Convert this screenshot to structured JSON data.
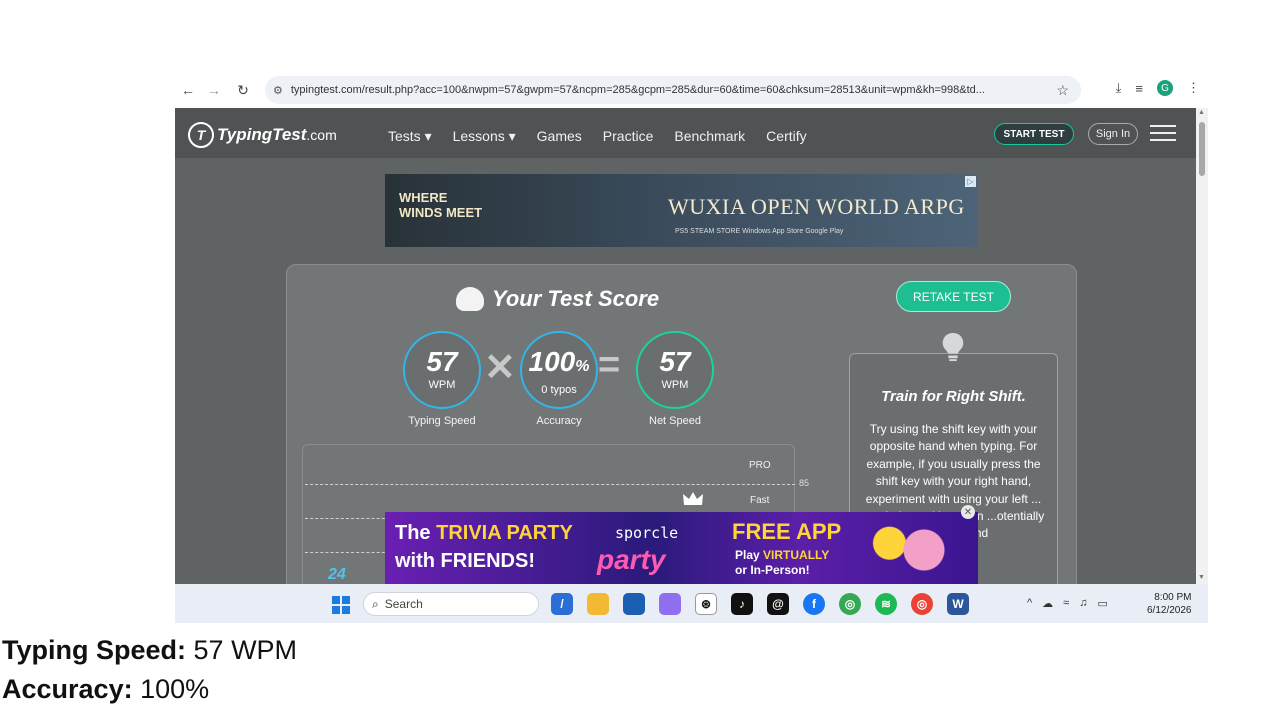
{
  "browser": {
    "url": "typingtest.com/result.php?acc=100&nwpm=57&gwpm=57&ncpm=285&gcpm=285&dur=60&time=60&chksum=28513&unit=wpm&kh=998&td...",
    "avatar_letter": "G"
  },
  "site": {
    "logo_text": "TypingTest",
    "logo_suffix": ".com",
    "logo_mark": "T",
    "menu": [
      "Tests ▾",
      "Lessons ▾",
      "Games",
      "Practice",
      "Benchmark",
      "Certify"
    ],
    "start_test": "START TEST",
    "sign_in": "Sign In"
  },
  "ad_top": {
    "brand": "WHERE\nWINDS MEET",
    "headline": "WUXIA OPEN WORLD ARPG",
    "platforms": "PS5   STEAM   STORE   Windows   App Store   Google Play"
  },
  "score": {
    "title": "Your Test Score",
    "retake": "RETAKE TEST",
    "typing_speed": {
      "value": "57",
      "unit": "WPM",
      "caption": "Typing Speed"
    },
    "accuracy": {
      "value": "100",
      "unit_suffix": "%",
      "sub": "0 typos",
      "caption": "Accuracy"
    },
    "net_speed": {
      "value": "57",
      "unit": "WPM",
      "caption": "Net Speed"
    }
  },
  "gauge": {
    "levels": [
      {
        "label": "PRO",
        "threshold": "85"
      },
      {
        "label": "Fast",
        "threshold": ""
      }
    ],
    "marker": "24"
  },
  "tip": {
    "title": "Train for Right Shift.",
    "body": "Try using the shift key with your opposite hand when typing. For example, if you usually press the shift key with your right hand, experiment with using your left ... can help ...ad between ...otentially ... speed and"
  },
  "ad_bottom": {
    "line1a": "The ",
    "line1b": "TRIVIA PARTY",
    "line2": "with FRIENDS!",
    "sporcle": "sporcle",
    "party": "party",
    "free_app": "FREE APP",
    "play1": "Play ",
    "play1b": "VIRTUALLY",
    "play2": "or In-Person!"
  },
  "taskbar": {
    "search_label": "Search",
    "time": "8:00 PM",
    "date": "6/12/2026"
  },
  "summary": {
    "speed_label": "Typing Speed:",
    "speed_value": "57 WPM",
    "accuracy_label": "Accuracy:",
    "accuracy_value": "100%"
  },
  "colors": {
    "accent_green": "#1dbf92",
    "ring_blue": "#33b6e6",
    "ring_green": "#19d3a0"
  }
}
